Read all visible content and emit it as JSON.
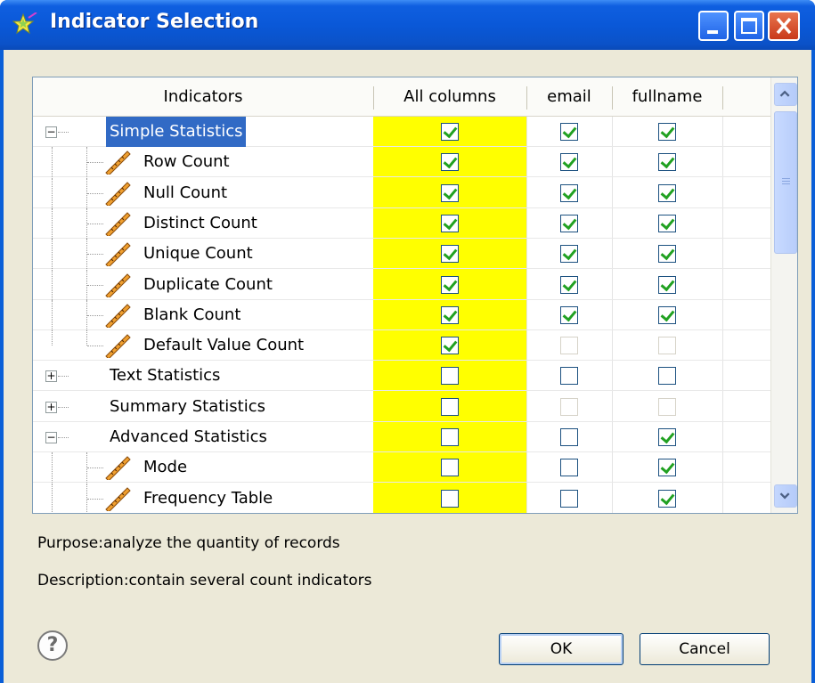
{
  "window": {
    "title": "Indicator Selection",
    "title_icon": "star-wand-icon"
  },
  "table": {
    "columns": [
      "Indicators",
      "All columns",
      "email",
      "fullname"
    ],
    "rows": [
      {
        "label": "Simple Statistics",
        "level": 0,
        "expander": "minus",
        "selected": true,
        "all": "checked",
        "email": "checked",
        "fullname": "checked"
      },
      {
        "label": "Row Count",
        "level": 1,
        "icon": "ruler-icon",
        "all": "checked",
        "email": "checked",
        "fullname": "checked"
      },
      {
        "label": "Null Count",
        "level": 1,
        "icon": "ruler-icon",
        "all": "checked",
        "email": "checked",
        "fullname": "checked"
      },
      {
        "label": "Distinct Count",
        "level": 1,
        "icon": "ruler-icon",
        "all": "checked",
        "email": "checked",
        "fullname": "checked"
      },
      {
        "label": "Unique Count",
        "level": 1,
        "icon": "ruler-icon",
        "all": "checked",
        "email": "checked",
        "fullname": "checked"
      },
      {
        "label": "Duplicate Count",
        "level": 1,
        "icon": "ruler-icon",
        "all": "checked",
        "email": "checked",
        "fullname": "checked"
      },
      {
        "label": "Blank Count",
        "level": 1,
        "icon": "ruler-icon",
        "all": "checked",
        "email": "checked",
        "fullname": "checked"
      },
      {
        "label": "Default Value Count",
        "level": 1,
        "icon": "ruler-icon",
        "last": true,
        "all": "checked",
        "email": "disabled",
        "fullname": "disabled"
      },
      {
        "label": "Text Statistics",
        "level": 0,
        "expander": "plus",
        "all": "unchecked",
        "email": "unchecked",
        "fullname": "unchecked"
      },
      {
        "label": "Summary Statistics",
        "level": 0,
        "expander": "plus",
        "all": "unchecked",
        "email": "disabled",
        "fullname": "disabled"
      },
      {
        "label": "Advanced Statistics",
        "level": 0,
        "expander": "minus",
        "all": "unchecked",
        "email": "unchecked",
        "fullname": "checked"
      },
      {
        "label": "Mode",
        "level": 1,
        "icon": "ruler-icon",
        "all": "unchecked",
        "email": "unchecked",
        "fullname": "checked"
      },
      {
        "label": "Frequency Table",
        "level": 1,
        "icon": "ruler-icon",
        "all": "unchecked",
        "email": "unchecked",
        "fullname": "checked"
      }
    ]
  },
  "info": {
    "purpose": "Purpose:analyze the quantity of records",
    "description": "Description:contain several count indicators"
  },
  "buttons": {
    "ok": "OK",
    "cancel": "Cancel",
    "help": "?"
  },
  "colors": {
    "titlebar": "#0a58d8",
    "all_columns_bg": "#ffff00",
    "selection": "#316ac5",
    "check": "#21a121"
  }
}
